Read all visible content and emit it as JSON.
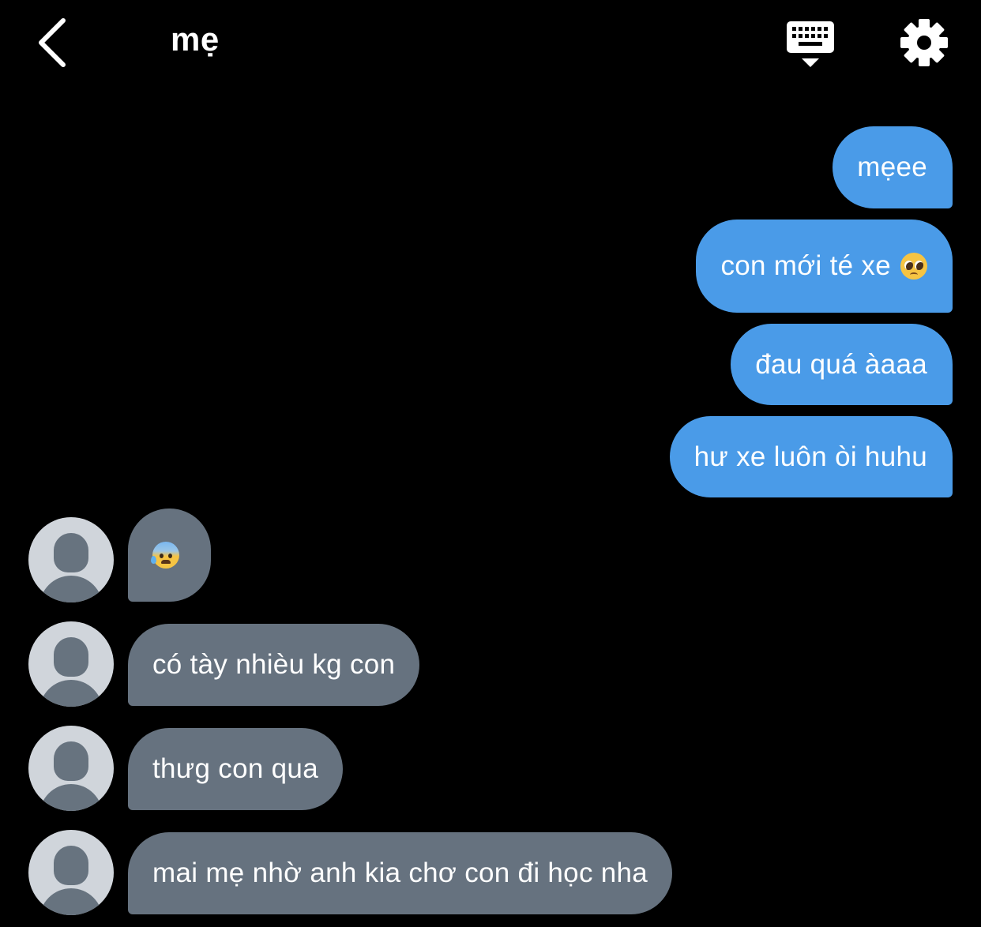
{
  "header": {
    "back_icon": "chevron-left-icon",
    "title": "mẹ",
    "keyboard_icon": "keyboard-hide-icon",
    "settings_icon": "gear-icon"
  },
  "colors": {
    "background": "#000000",
    "outgoing_bubble": "#4a9be8",
    "incoming_bubble": "#66727f",
    "avatar_bg": "#d0d5db",
    "text": "#ffffff"
  },
  "messages": {
    "outgoing": [
      {
        "text": "mẹee"
      },
      {
        "text": "con mới té xe",
        "emoji": "pleading-face-emoji"
      },
      {
        "text": "đau quá àaaa"
      },
      {
        "text": "hư xe luôn òi huhu"
      }
    ],
    "incoming": [
      {
        "text": "",
        "emoji": "anxious-face-with-sweat-emoji"
      },
      {
        "text": "có tày nhièu kg con"
      },
      {
        "text": "thưg con qua"
      },
      {
        "text": "mai mẹ nhờ anh kia chơ con đi học nha"
      }
    ]
  }
}
